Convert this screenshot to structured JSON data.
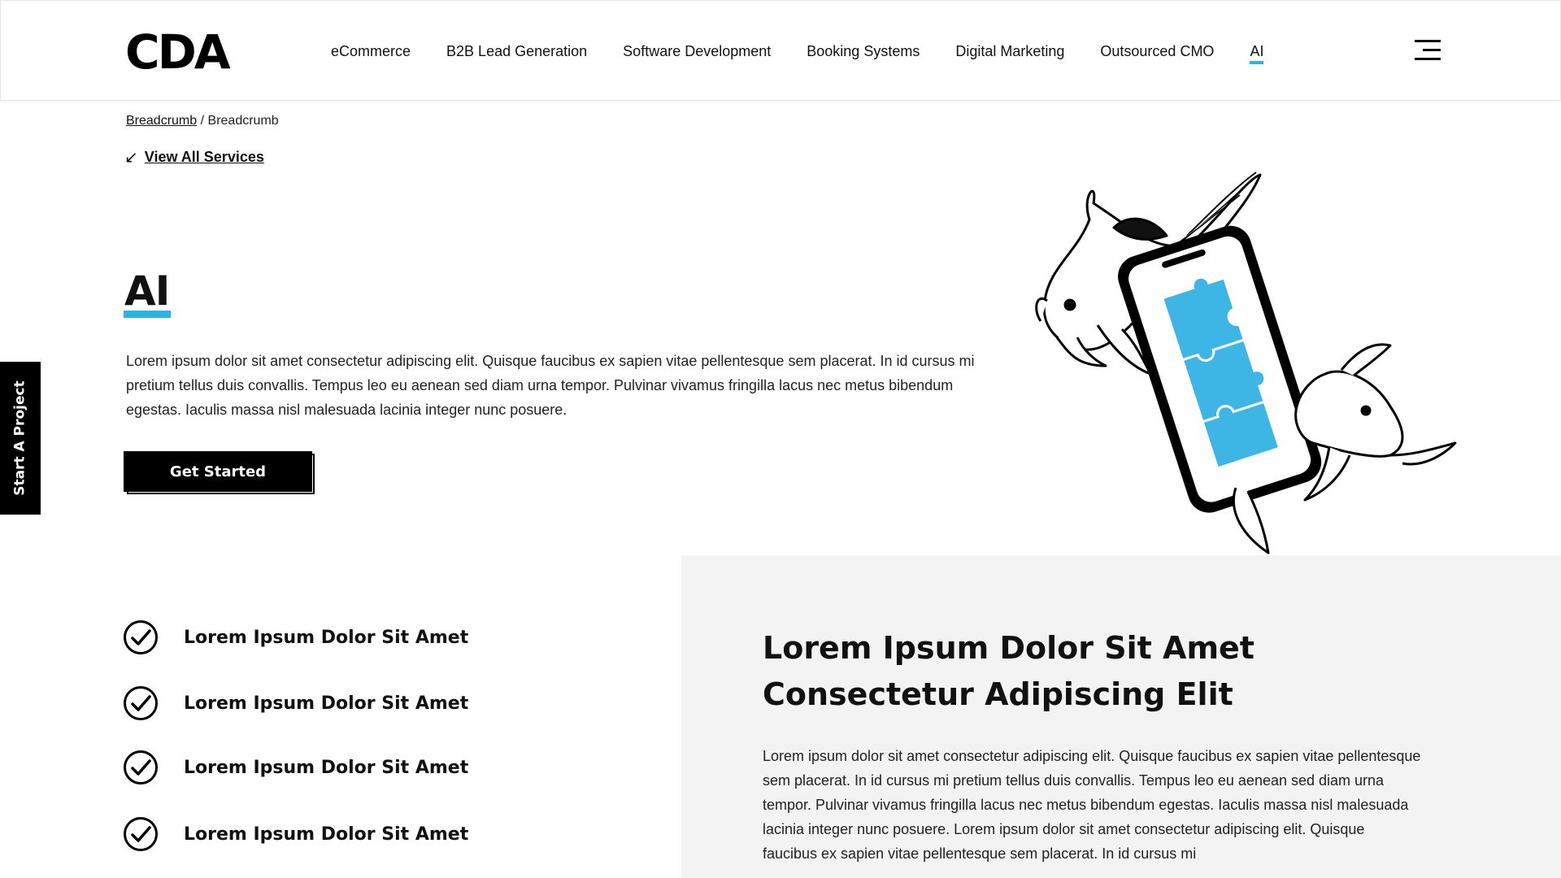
{
  "header": {
    "logo": "CDA",
    "nav": [
      {
        "label": "eCommerce",
        "active": false
      },
      {
        "label": "B2B Lead Generation",
        "active": false
      },
      {
        "label": "Software Development",
        "active": false
      },
      {
        "label": "Booking Systems",
        "active": false
      },
      {
        "label": "Digital Marketing",
        "active": false
      },
      {
        "label": "Outsourced CMO",
        "active": false
      },
      {
        "label": "AI",
        "active": true
      }
    ],
    "menu_icon": "hamburger-icon"
  },
  "breadcrumb": {
    "first": "Breadcrumb",
    "separator": "/",
    "current": "Breadcrumb"
  },
  "view_all": {
    "label": "View All Services",
    "icon": "arrow-down-left-icon"
  },
  "hero": {
    "title": "AI",
    "text": "Lorem ipsum dolor sit amet consectetur adipiscing elit. Quisque faucibus ex sapien vitae pellentesque sem placerat. In id cursus mi pretium tellus duis convallis. Tempus leo eu aenean sed diam urna tempor. Pulvinar vivamus fringilla lacus nec metus bibendum egestas. Iaculis massa nisl malesuada lacinia integer nunc posuere.",
    "button": "Get Started"
  },
  "side_tab": "Start A Project",
  "checklist": [
    "Lorem Ipsum Dolor Sit Amet",
    "Lorem Ipsum Dolor Sit Amet",
    "Lorem Ipsum Dolor Sit Amet",
    "Lorem Ipsum Dolor Sit Amet"
  ],
  "panel": {
    "title": "Lorem Ipsum Dolor Sit Amet Consectetur Adipiscing Elit",
    "text": "Lorem ipsum dolor sit amet consectetur adipiscing elit. Quisque faucibus ex sapien vitae pellentesque sem placerat. In id cursus mi pretium tellus duis convallis. Tempus leo eu aenean sed diam urna tempor. Pulvinar vivamus fringilla lacus nec metus bibendum egestas. Iaculis massa nisl malesuada lacinia integer nunc posuere. Lorem ipsum dolor sit amet consectetur adipiscing elit. Quisque faucibus ex sapien vitae pellentesque sem placerat. In id cursus mi"
  },
  "colors": {
    "accent": "#29b4e6",
    "panel_bg": "#f3f3f3",
    "text": "#111111"
  }
}
